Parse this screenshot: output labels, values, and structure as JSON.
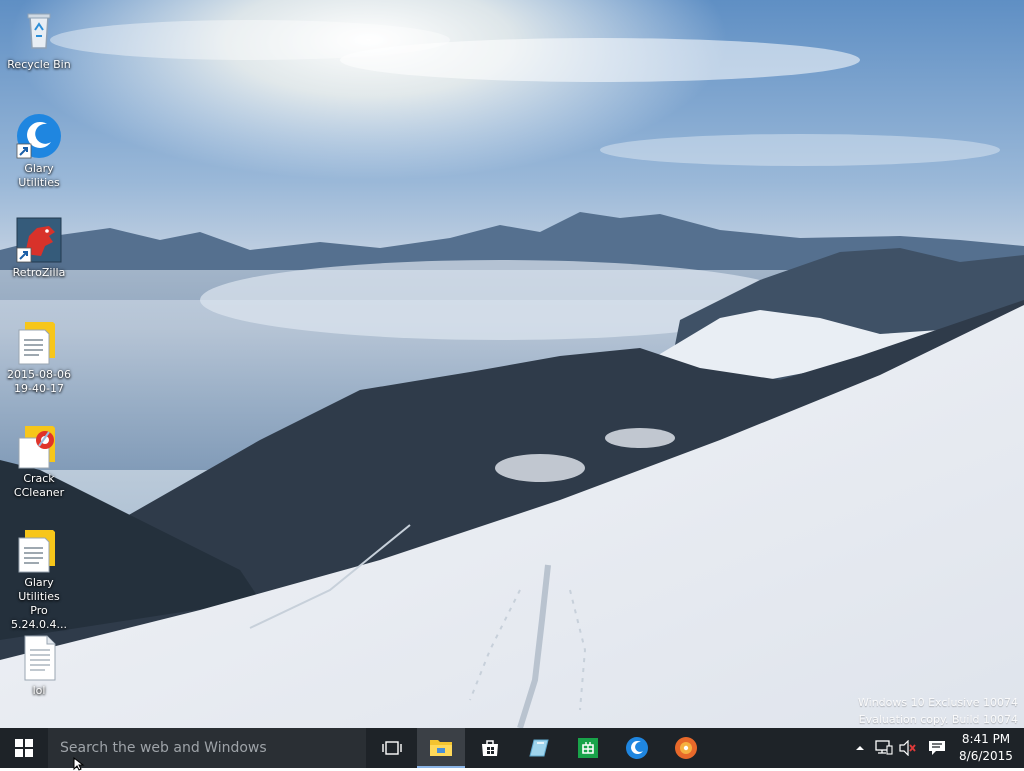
{
  "desktop": {
    "icons": [
      {
        "label": "Recycle Bin",
        "icon": "recycle-bin-icon"
      },
      {
        "label": "Glary Utilities",
        "icon": "glary-utilities-icon"
      },
      {
        "label": "RetroZilla",
        "icon": "retrozilla-icon"
      },
      {
        "label": "2015-08-06\n19-40-17",
        "icon": "document-icon"
      },
      {
        "label": "Crack\nCCleaner",
        "icon": "ccleaner-icon"
      },
      {
        "label": "Glary Utilities\nPro 5.24.0.4...",
        "icon": "document-icon"
      },
      {
        "label": "lol",
        "icon": "text-file-icon"
      }
    ],
    "watermark": {
      "line1": "Windows 10 Exclusive 10074",
      "line2": "Evaluation copy. Build 10074"
    }
  },
  "taskbar": {
    "start_icon": "windows-logo-icon",
    "search_placeholder": "Search the web and Windows",
    "task_view_icon": "task-view-icon",
    "pinned": [
      {
        "name": "file-explorer",
        "icon": "folder-icon",
        "active": true
      },
      {
        "name": "store",
        "icon": "store-icon",
        "active": false
      },
      {
        "name": "glass-app",
        "icon": "glass-icon",
        "active": false
      },
      {
        "name": "excel-like-app",
        "icon": "green-app-icon",
        "active": false
      },
      {
        "name": "glary-utilities",
        "icon": "glary-utilities-icon",
        "active": false
      },
      {
        "name": "orange-app",
        "icon": "orange-disc-icon",
        "active": false
      }
    ],
    "tray": {
      "icons": [
        "chevron-up-icon",
        "network-icon",
        "volume-muted-icon",
        "action-center-icon"
      ],
      "time": "8:41 PM",
      "date": "8/6/2015"
    }
  },
  "colors": {
    "taskbar": "#1e2328",
    "search_box": "#2a2f34",
    "accent": "#8ab4e6"
  }
}
